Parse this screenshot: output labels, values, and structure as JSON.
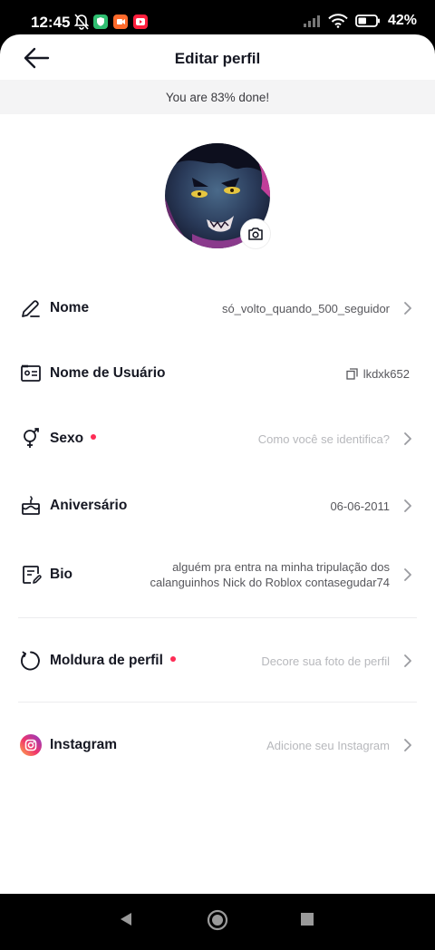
{
  "status_bar": {
    "time": "12:45",
    "battery": "42%",
    "icons": [
      "mute-bell-icon",
      "shield-app-icon",
      "orange-app-icon",
      "youtube-icon",
      "signal-icon",
      "wifi-icon",
      "battery-icon"
    ]
  },
  "header": {
    "title": "Editar perfil",
    "back_icon": "arrow-left-icon"
  },
  "progress": {
    "text": "You are 83% done!",
    "percent": 83
  },
  "avatar": {
    "camera_icon": "camera-icon"
  },
  "fields": {
    "nome": {
      "label": "Nome",
      "value": "só_volto_quando_500_seguidor",
      "icon": "pencil-icon"
    },
    "usuario": {
      "label": "Nome de Usuário",
      "value": "lkdxk652",
      "icon": "id-card-icon",
      "copy_icon": "copy-icon"
    },
    "sexo": {
      "label": "Sexo",
      "value": "Como você se identifica?",
      "icon": "gender-icon"
    },
    "aniversario": {
      "label": "Aniversário",
      "value": "06-06-2011",
      "icon": "cake-icon"
    },
    "bio": {
      "label": "Bio",
      "value_line1": "alguém pra entra na minha tripulação dos",
      "value_line2": "calanguinhos Nick do Roblox contasegudar74",
      "icon": "note-icon"
    },
    "moldura": {
      "label": "Moldura de perfil",
      "value": "Decore sua foto de perfil",
      "icon": "frame-icon"
    },
    "instagram": {
      "label": "Instagram",
      "value": "Adicione seu Instagram",
      "icon": "instagram-icon"
    }
  },
  "colors": {
    "accent_red": "#fe2c55",
    "text_primary": "#161823",
    "text_secondary": "#57575c",
    "placeholder": "#b7b8bc",
    "banner_bg": "#f4f4f5"
  },
  "nav": {
    "back_icon": "nav-back-icon",
    "home_icon": "nav-home-icon",
    "recents_icon": "nav-recents-icon"
  }
}
